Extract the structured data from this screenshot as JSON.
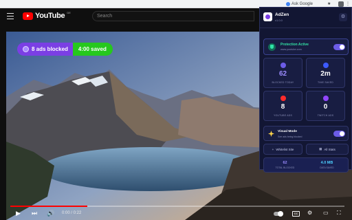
{
  "browser": {
    "ask_google": "Ask Google"
  },
  "youtube": {
    "logo_text": "YouTube",
    "logo_sup": "DE",
    "search_placeholder": "Search"
  },
  "overlay": {
    "ads_blocked": "8 ads blocked",
    "time_saved": "4:00 saved"
  },
  "player": {
    "time": "0:00 / 0:22",
    "progress_fraction": 0.23,
    "cc_label": "CC"
  },
  "popup": {
    "title": "AdZen",
    "version": "v1.0.0",
    "protection": {
      "title": "Protection Active",
      "domain": "www.youtube.com",
      "enabled": true
    },
    "stats": [
      {
        "value": "62",
        "label": "BLOCKED TODAY",
        "icon": "shield-icon",
        "color": "#6c5ce7"
      },
      {
        "value": "2m",
        "label": "TIME SAVED",
        "icon": "clock-icon",
        "color": "#3d5afe"
      },
      {
        "value": "8",
        "label": "YOUTUBE ADS",
        "icon": "youtube-icon",
        "color": "#ff2b2b"
      },
      {
        "value": "0",
        "label": "TWITCH ADS",
        "icon": "twitch-icon",
        "color": "#9146ff"
      }
    ],
    "visual_mode": {
      "title": "Visual Mode",
      "description": "See ads being blocked",
      "enabled": true
    },
    "buttons": {
      "whitelist": "Whitelist Site",
      "all_stats": "All Stats"
    },
    "summary": {
      "total_blocked_value": "62",
      "total_blocked_label": "TOTAL BLOCKED",
      "data_saved_value": "4.0 MB",
      "data_saved_label": "DATA SAVED"
    }
  },
  "colors": {
    "popup_bg": "#121633",
    "accent_purple": "#7b3fe4",
    "accent_green": "#26c81d",
    "protection_green": "#33e1a4",
    "youtube_red": "#ff0000"
  }
}
